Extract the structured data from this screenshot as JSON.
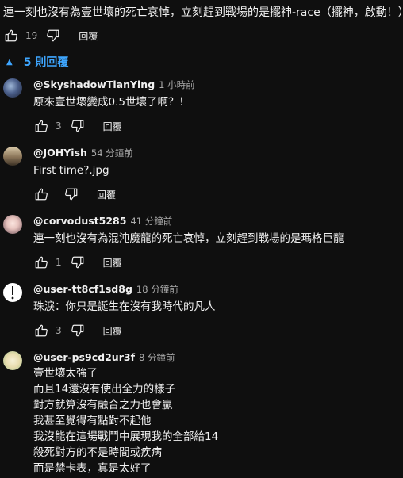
{
  "parent": {
    "text": "連一刻也沒有為壹世壞的死亡哀悼，立刻趕到戰場的是擺神-race（擺神，啟動！）",
    "likes": "19",
    "reply_label": "回覆"
  },
  "replies_toggle": {
    "label": "5 則回覆",
    "icon": "caret-up-icon"
  },
  "replies": [
    {
      "handle": "@SkyshadowTianYing",
      "time": "1 小時前",
      "lines": [
        "原來壹世壞變成0.5世壞了啊？！"
      ],
      "likes": "3",
      "reply_label": "回覆"
    },
    {
      "handle": "@JOHYish",
      "time": "54 分鐘前",
      "lines": [
        "First time?.jpg"
      ],
      "likes": "",
      "reply_label": "回覆"
    },
    {
      "handle": "@corvodust5285",
      "time": "41 分鐘前",
      "lines": [
        "連一刻也沒有為混沌魔龍的死亡哀悼，立刻趕到戰場的是瑪格巨龍"
      ],
      "likes": "1",
      "reply_label": "回覆"
    },
    {
      "handle": "@user-tt8cf1sd8g",
      "time": "18 分鐘前",
      "lines": [
        "珠淚：你只是誕生在沒有我時代的凡人"
      ],
      "likes": "3",
      "reply_label": "回覆"
    },
    {
      "handle": "@user-ps9cd2ur3f",
      "time": "8 分鐘前",
      "lines": [
        "壹世壞太強了",
        "而且14還沒有使出全力的樣子",
        "對方就算沒有融合之力也會贏",
        "我甚至覺得有點對不起他",
        "我沒能在這場戰鬥中展現我的全部給14",
        "殺死對方的不是時間或疾病",
        "而是禁卡表，真是太好了"
      ],
      "likes": "",
      "reply_label": "回覆"
    }
  ],
  "icons": {
    "like": "thumbs-up-icon",
    "dislike": "thumbs-down-icon"
  },
  "colors": {
    "background": "#0f0f0f",
    "text": "#f1f1f1",
    "secondary": "#aaaaaa",
    "link": "#3ea6ff"
  }
}
